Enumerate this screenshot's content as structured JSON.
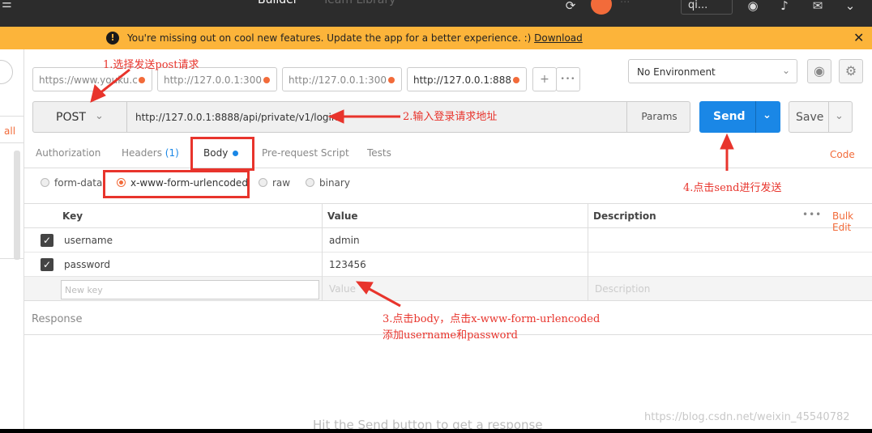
{
  "topbar": {
    "tab_builder": "Builder",
    "tab_team": "Team Library",
    "user_name": "...",
    "user_box": "qi..."
  },
  "banner": {
    "message": "You're missing out on cool new features. Update the app for a better experience. :) ",
    "link": "Download",
    "close": "✕"
  },
  "sidebar": {
    "all_label": "all"
  },
  "request_tabs": [
    {
      "label": "https://www.youku.c",
      "active": false
    },
    {
      "label": "http://127.0.0.1:300",
      "active": false
    },
    {
      "label": "http://127.0.0.1:300",
      "active": false
    },
    {
      "label": "http://127.0.0.1:888",
      "active": true
    }
  ],
  "tab_buttons": {
    "add": "+",
    "more": "•••"
  },
  "environment": {
    "selected": "No Environment"
  },
  "request": {
    "method": "POST",
    "url": "http://127.0.0.1:8888/api/private/v1/login",
    "params_label": "Params",
    "send_label": "Send",
    "save_label": "Save"
  },
  "subtabs": {
    "authorization": "Authorization",
    "headers": "Headers",
    "headers_count": "(1)",
    "body": "Body",
    "pre_request": "Pre-request Script",
    "tests": "Tests",
    "code": "Code"
  },
  "body_types": {
    "form_data": "form-data",
    "urlencoded": "x-www-form-urlencoded",
    "raw": "raw",
    "binary": "binary",
    "selected": "x-www-form-urlencoded"
  },
  "table": {
    "headers": {
      "key": "Key",
      "value": "Value",
      "description": "Description"
    },
    "dots": "•••",
    "bulk_edit": "Bulk Edit",
    "rows": [
      {
        "key": "username",
        "value": "admin",
        "checked": true
      },
      {
        "key": "password",
        "value": "123456",
        "checked": true
      }
    ],
    "new_key_placeholder": "New key",
    "new_value_placeholder": "Value",
    "new_desc_placeholder": "Description"
  },
  "response": {
    "label": "Response",
    "hint": "Hit the Send button to get a response"
  },
  "annotations": {
    "step1": "1.选择发送post请求",
    "step2": "2.输入登录请求地址",
    "step3_line1": "3.点击body，点击x-www-form-urlencoded",
    "step3_line2": "添加username和password",
    "step4": "4.点击send进行发送"
  },
  "watermark": "https://blog.csdn.net/weixin_45540782",
  "colors": {
    "accent_orange": "#f26b3a",
    "send_blue": "#1a87e6",
    "banner_yellow": "#fcb43a",
    "annotation_red": "#e8342c"
  }
}
